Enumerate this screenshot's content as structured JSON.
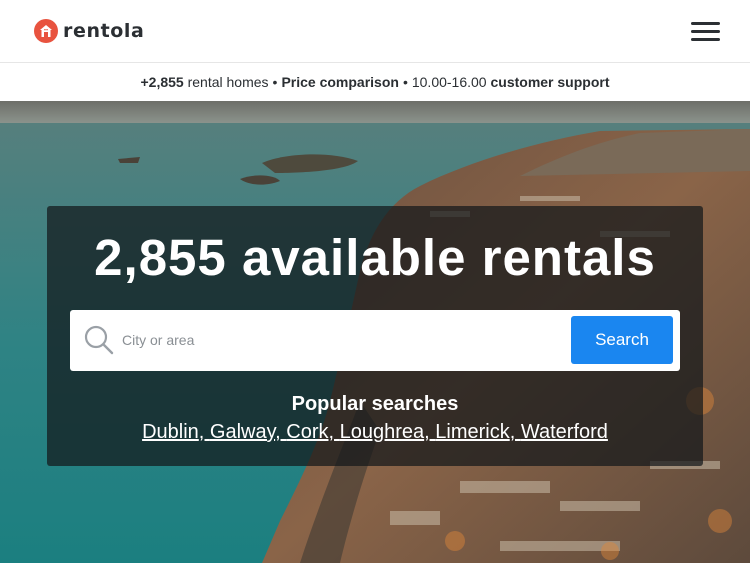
{
  "header": {
    "brand": "rentola",
    "logo_icon": "house-icon",
    "menu_icon": "hamburger-menu-icon",
    "brand_color": "#e8533f"
  },
  "infobar": {
    "count": "+2,855",
    "rental_homes": "rental homes",
    "separator": "•",
    "price_comparison": "Price comparison",
    "hours": "10.00-16.00",
    "support": "customer support"
  },
  "hero": {
    "title": "2,855 available rentals",
    "search": {
      "placeholder": "City or area",
      "value": "",
      "button_label": "Search",
      "button_color": "#1a86f0"
    },
    "popular": {
      "title": "Popular searches",
      "links": [
        "Dublin",
        "Galway",
        "Cork",
        "Loughrea",
        "Limerick",
        "Waterford"
      ]
    }
  }
}
